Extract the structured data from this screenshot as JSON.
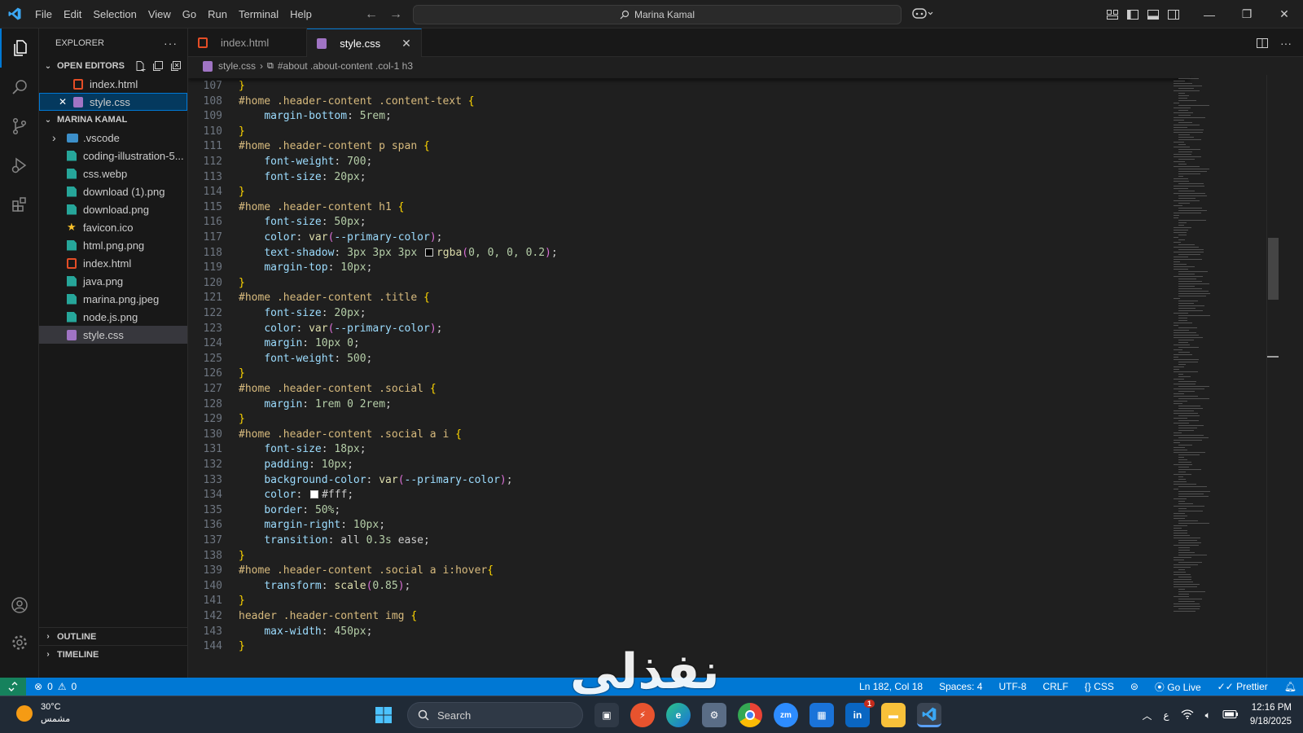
{
  "menu": [
    "File",
    "Edit",
    "Selection",
    "View",
    "Go",
    "Run",
    "Terminal",
    "Help"
  ],
  "command_center": "Marina Kamal",
  "explorer": {
    "title": "EXPLORER",
    "open_editors_label": "OPEN EDITORS",
    "open_editors": [
      "index.html",
      "style.css"
    ],
    "project_label": "MARINA KAMAL",
    "files": [
      {
        "name": ".vscode",
        "kind": "folder"
      },
      {
        "name": "coding-illustration-5...",
        "kind": "img"
      },
      {
        "name": "css.webp",
        "kind": "img"
      },
      {
        "name": "download (1).png",
        "kind": "img"
      },
      {
        "name": "download.png",
        "kind": "img"
      },
      {
        "name": "favicon.ico",
        "kind": "fav"
      },
      {
        "name": "html.png.png",
        "kind": "img"
      },
      {
        "name": "index.html",
        "kind": "html"
      },
      {
        "name": "java.png",
        "kind": "img"
      },
      {
        "name": "marina.png.jpeg",
        "kind": "img"
      },
      {
        "name": "node.js.png",
        "kind": "img"
      },
      {
        "name": "style.css",
        "kind": "css"
      }
    ],
    "outline_label": "OUTLINE",
    "timeline_label": "TIMELINE"
  },
  "tabs": [
    {
      "label": "index.html",
      "active": false
    },
    {
      "label": "style.css",
      "active": true
    }
  ],
  "breadcrumb": {
    "file": "style.css",
    "symbol": "#about .about-content .col-1 h3"
  },
  "code": [
    {
      "n": "107",
      "parts": [
        [
          "br",
          "}"
        ]
      ]
    },
    {
      "n": "108",
      "parts": [
        [
          "sel",
          "#home .header-content .content-text "
        ],
        [
          "br",
          "{"
        ]
      ]
    },
    {
      "n": "109",
      "parts": [
        [
          "ind",
          "    "
        ],
        [
          "prop",
          "margin-bottom"
        ],
        [
          "txt",
          ": "
        ],
        [
          "num",
          "5rem"
        ],
        [
          "txt",
          ";"
        ]
      ]
    },
    {
      "n": "110",
      "parts": [
        [
          "br",
          "}"
        ]
      ]
    },
    {
      "n": "111",
      "parts": [
        [
          "sel",
          "#home .header-content p span "
        ],
        [
          "br",
          "{"
        ]
      ]
    },
    {
      "n": "112",
      "parts": [
        [
          "ind",
          "    "
        ],
        [
          "prop",
          "font-weight"
        ],
        [
          "txt",
          ": "
        ],
        [
          "num",
          "700"
        ],
        [
          "txt",
          ";"
        ]
      ]
    },
    {
      "n": "113",
      "parts": [
        [
          "ind",
          "    "
        ],
        [
          "prop",
          "font-size"
        ],
        [
          "txt",
          ": "
        ],
        [
          "num",
          "20px"
        ],
        [
          "txt",
          ";"
        ]
      ]
    },
    {
      "n": "114",
      "parts": [
        [
          "br",
          "}"
        ]
      ]
    },
    {
      "n": "115",
      "parts": [
        [
          "sel",
          "#home .header-content h1 "
        ],
        [
          "br",
          "{"
        ]
      ]
    },
    {
      "n": "116",
      "parts": [
        [
          "ind",
          "    "
        ],
        [
          "prop",
          "font-size"
        ],
        [
          "txt",
          ": "
        ],
        [
          "num",
          "50px"
        ],
        [
          "txt",
          ";"
        ]
      ]
    },
    {
      "n": "117",
      "parts": [
        [
          "ind",
          "    "
        ],
        [
          "prop",
          "color"
        ],
        [
          "txt",
          ": "
        ],
        [
          "fn",
          "var"
        ],
        [
          "br2",
          "("
        ],
        [
          "var",
          "--primary-color"
        ],
        [
          "br2",
          ")"
        ],
        [
          "txt",
          ";"
        ]
      ]
    },
    {
      "n": "118",
      "parts": [
        [
          "ind",
          "    "
        ],
        [
          "prop",
          "text-shadow"
        ],
        [
          "txt",
          ": "
        ],
        [
          "num",
          "3px 3px 3px "
        ],
        [
          "swatch",
          "#000000"
        ],
        [
          "fn",
          "rgba"
        ],
        [
          "br2",
          "("
        ],
        [
          "num",
          "0, 0, 0, 0.2"
        ],
        [
          "br2",
          ")"
        ],
        [
          "txt",
          ";"
        ]
      ]
    },
    {
      "n": "119",
      "parts": [
        [
          "ind",
          "    "
        ],
        [
          "prop",
          "margin-top"
        ],
        [
          "txt",
          ": "
        ],
        [
          "num",
          "10px"
        ],
        [
          "txt",
          ";"
        ]
      ]
    },
    {
      "n": "120",
      "parts": [
        [
          "br",
          "}"
        ]
      ]
    },
    {
      "n": "121",
      "parts": [
        [
          "sel",
          "#home .header-content .title "
        ],
        [
          "br",
          "{"
        ]
      ]
    },
    {
      "n": "122",
      "parts": [
        [
          "ind",
          "    "
        ],
        [
          "prop",
          "font-size"
        ],
        [
          "txt",
          ": "
        ],
        [
          "num",
          "20px"
        ],
        [
          "txt",
          ";"
        ]
      ]
    },
    {
      "n": "123",
      "parts": [
        [
          "ind",
          "    "
        ],
        [
          "prop",
          "color"
        ],
        [
          "txt",
          ": "
        ],
        [
          "fn",
          "var"
        ],
        [
          "br2",
          "("
        ],
        [
          "var",
          "--primary-color"
        ],
        [
          "br2",
          ")"
        ],
        [
          "txt",
          ";"
        ]
      ]
    },
    {
      "n": "124",
      "parts": [
        [
          "ind",
          "    "
        ],
        [
          "prop",
          "margin"
        ],
        [
          "txt",
          ": "
        ],
        [
          "num",
          "10px 0"
        ],
        [
          "txt",
          ";"
        ]
      ]
    },
    {
      "n": "125",
      "parts": [
        [
          "ind",
          "    "
        ],
        [
          "prop",
          "font-weight"
        ],
        [
          "txt",
          ": "
        ],
        [
          "num",
          "500"
        ],
        [
          "txt",
          ";"
        ]
      ]
    },
    {
      "n": "126",
      "parts": [
        [
          "br",
          "}"
        ]
      ]
    },
    {
      "n": "127",
      "parts": [
        [
          "sel",
          "#home .header-content .social "
        ],
        [
          "br",
          "{"
        ]
      ]
    },
    {
      "n": "128",
      "parts": [
        [
          "ind",
          "    "
        ],
        [
          "prop",
          "margin"
        ],
        [
          "txt",
          ": "
        ],
        [
          "num",
          "1rem 0 2rem"
        ],
        [
          "txt",
          ";"
        ]
      ]
    },
    {
      "n": "129",
      "parts": [
        [
          "br",
          "}"
        ]
      ]
    },
    {
      "n": "130",
      "parts": [
        [
          "sel",
          "#home .header-content .social a i "
        ],
        [
          "br",
          "{"
        ]
      ]
    },
    {
      "n": "131",
      "parts": [
        [
          "ind",
          "    "
        ],
        [
          "prop",
          "font-size"
        ],
        [
          "txt",
          ": "
        ],
        [
          "num",
          "18px"
        ],
        [
          "txt",
          ";"
        ]
      ]
    },
    {
      "n": "132",
      "parts": [
        [
          "ind",
          "    "
        ],
        [
          "prop",
          "padding"
        ],
        [
          "txt",
          ": "
        ],
        [
          "num",
          "10px"
        ],
        [
          "txt",
          ";"
        ]
      ]
    },
    {
      "n": "133",
      "parts": [
        [
          "ind",
          "    "
        ],
        [
          "prop",
          "background-color"
        ],
        [
          "txt",
          ": "
        ],
        [
          "fn",
          "var"
        ],
        [
          "br2",
          "("
        ],
        [
          "var",
          "--primary-color"
        ],
        [
          "br2",
          ")"
        ],
        [
          "txt",
          ";"
        ]
      ]
    },
    {
      "n": "134",
      "parts": [
        [
          "ind",
          "    "
        ],
        [
          "prop",
          "color"
        ],
        [
          "txt",
          ": "
        ],
        [
          "swatch",
          "#ffffff"
        ],
        [
          "txt",
          "#fff;"
        ]
      ]
    },
    {
      "n": "135",
      "parts": [
        [
          "ind",
          "    "
        ],
        [
          "prop",
          "border"
        ],
        [
          "txt",
          ": "
        ],
        [
          "num",
          "50%"
        ],
        [
          "txt",
          ";"
        ]
      ]
    },
    {
      "n": "136",
      "parts": [
        [
          "ind",
          "    "
        ],
        [
          "prop",
          "margin-right"
        ],
        [
          "txt",
          ": "
        ],
        [
          "num",
          "10px"
        ],
        [
          "txt",
          ";"
        ]
      ]
    },
    {
      "n": "137",
      "parts": [
        [
          "ind",
          "    "
        ],
        [
          "prop",
          "transition"
        ],
        [
          "txt",
          ": all "
        ],
        [
          "num",
          "0.3s"
        ],
        [
          "txt",
          " ease;"
        ]
      ]
    },
    {
      "n": "138",
      "parts": [
        [
          "br",
          "}"
        ]
      ]
    },
    {
      "n": "139",
      "parts": [
        [
          "sel",
          "#home .header-content .social a i:hover"
        ],
        [
          "br",
          "{"
        ]
      ]
    },
    {
      "n": "140",
      "parts": [
        [
          "ind",
          "    "
        ],
        [
          "prop",
          "transform"
        ],
        [
          "txt",
          ": "
        ],
        [
          "fn",
          "scale"
        ],
        [
          "br2",
          "("
        ],
        [
          "num",
          "0.85"
        ],
        [
          "br2",
          ")"
        ],
        [
          "txt",
          ";"
        ]
      ]
    },
    {
      "n": "141",
      "parts": [
        [
          "br",
          "}"
        ]
      ]
    },
    {
      "n": "142",
      "parts": [
        [
          "sel",
          "header .header-content img "
        ],
        [
          "br",
          "{"
        ]
      ]
    },
    {
      "n": "143",
      "parts": [
        [
          "ind",
          "    "
        ],
        [
          "prop",
          "max-width"
        ],
        [
          "txt",
          ": "
        ],
        [
          "num",
          "450px"
        ],
        [
          "txt",
          ";"
        ]
      ]
    },
    {
      "n": "144",
      "parts": [
        [
          "br",
          "}"
        ]
      ]
    }
  ],
  "statusbar": {
    "errors": "0",
    "warnings": "0",
    "position": "Ln 182, Col 18",
    "spaces": "Spaces: 4",
    "encoding": "UTF-8",
    "eol": "CRLF",
    "language": "CSS",
    "golive": "Go Live",
    "prettier": "Prettier"
  },
  "watermark": "نفذلي",
  "taskbar": {
    "temp": "30°C",
    "weather": "مشمس",
    "search": "Search",
    "time": "12:16 PM",
    "date": "9/18/2025",
    "lang": "ع",
    "badge": "1"
  },
  "colors": {
    "accent": "#0078d4",
    "statusbar": "#0078d4",
    "remote": "#16825d",
    "selector": "#d7ba7d",
    "property": "#9cdcfe",
    "number": "#b5cea8"
  }
}
